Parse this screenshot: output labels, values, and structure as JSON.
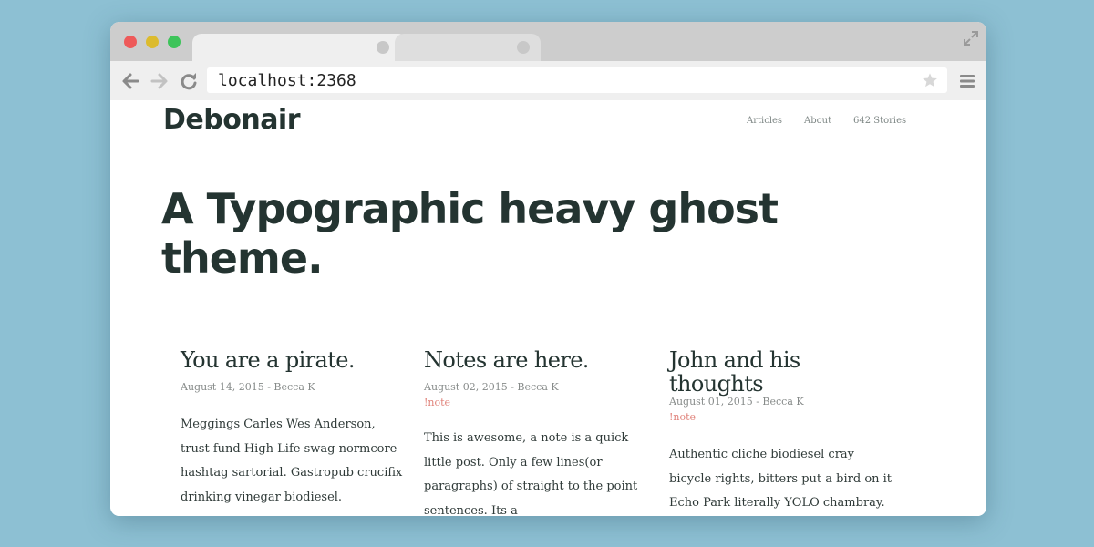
{
  "browser": {
    "url": "localhost:2368",
    "icons": {
      "back": "arrow-left-icon",
      "forward": "arrow-right-icon",
      "reload": "reload-icon",
      "star": "star-icon",
      "menu": "hamburger-menu-icon",
      "expand": "expand-icon"
    }
  },
  "site": {
    "title": "Debonair",
    "nav": [
      "Articles",
      "About",
      "642 Stories"
    ],
    "hero": "A Typographic heavy ghost theme."
  },
  "posts": [
    {
      "title": "You are a pirate.",
      "meta": "August 14, 2015 - Becca K",
      "tag": "",
      "body": "Meggings Carles Wes Anderson, trust fund High Life swag normcore hashtag sartorial. Gastropub crucifix drinking vinegar biodiesel."
    },
    {
      "title": "Notes are here.",
      "meta": "August 02, 2015 - Becca K",
      "tag": "!note",
      "body": "This is awesome, a note is a quick little post. Only a few lines(or paragraphs) of straight to the point sentences. Its a"
    },
    {
      "title": "John and his thoughts",
      "meta": "August 01, 2015 - Becca K",
      "tag": "!note",
      "body": "Authentic cliche biodiesel cray bicycle rights, bitters put a bird on it Echo Park literally YOLO chambray. Cronut"
    }
  ],
  "colors": {
    "background": "#8dc0d3",
    "text_dark": "#243431",
    "meta": "#878b8a",
    "tag": "#e0827a"
  }
}
